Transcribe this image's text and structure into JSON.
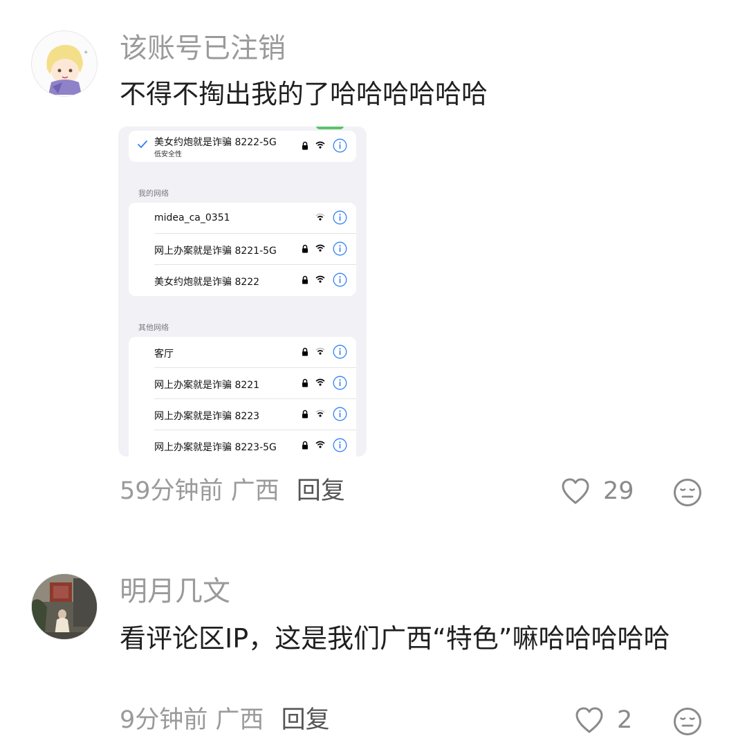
{
  "comments": [
    {
      "username": "该账号已注销",
      "text": "不得不掏出我的了哈哈哈哈哈哈",
      "time": "59分钟前",
      "location": "广西",
      "reply_label": "回复",
      "like_count": "29",
      "avatar_icon": "anime-avatar-icon",
      "attachment": {
        "connected": {
          "name": "美女约炮就是诈骗 8222-5G",
          "sub": "低安全性"
        },
        "my_networks_label": "我的网络",
        "my_networks": [
          {
            "name": "midea_ca_0351",
            "locked": false
          },
          {
            "name": "网上办案就是诈骗 8221-5G",
            "locked": true
          },
          {
            "name": "美女约炮就是诈骗 8222",
            "locked": true
          }
        ],
        "other_networks_label": "其他网络",
        "other_networks": [
          {
            "name": "客厅",
            "locked": true
          },
          {
            "name": "网上办案就是诈骗 8221",
            "locked": true
          },
          {
            "name": "网上办案就是诈骗 8223",
            "locked": true
          },
          {
            "name": "网上办案就是诈骗 8223-5G",
            "locked": true
          }
        ]
      }
    },
    {
      "username": "明月几文",
      "text": "看评论区IP，这是我们广西“特色”嘛哈哈哈哈哈",
      "time": "9分钟前",
      "location": "广西",
      "reply_label": "回复",
      "like_count": "2",
      "avatar_icon": "photo-avatar-icon"
    }
  ],
  "colors": {
    "muted_text": "#9a9a9a",
    "ios_blue": "#2f7ff6",
    "ios_green": "#5ac26b"
  }
}
